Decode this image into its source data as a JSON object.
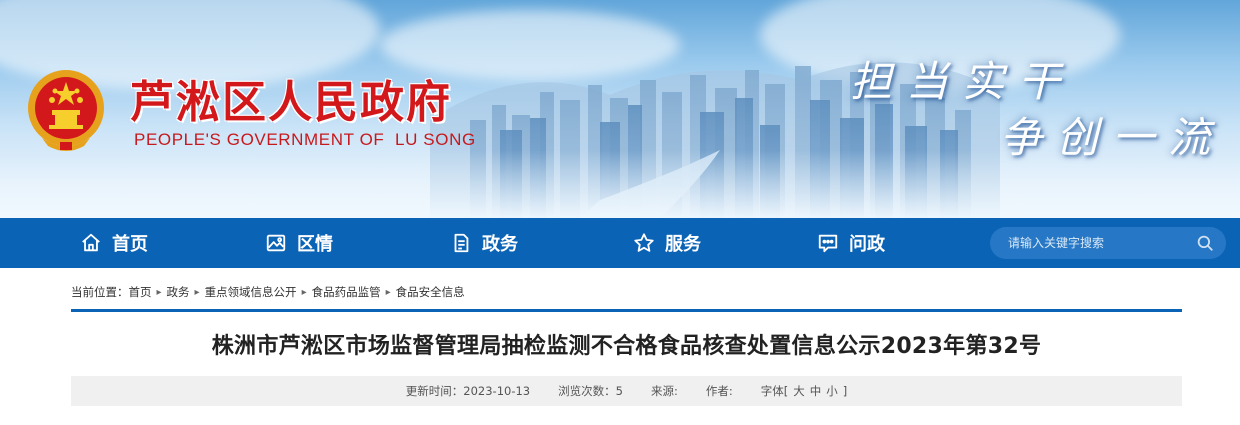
{
  "header": {
    "title": "芦淞区人民政府",
    "subtitle": "PEOPLE'S GOVERNMENT OF  LU SONG",
    "slogan_line1": "担当实干",
    "slogan_line2": "争创一流",
    "emblem_icon": "national-emblem-icon"
  },
  "nav": {
    "items": [
      {
        "label": "首页",
        "icon": "home-icon"
      },
      {
        "label": "区情",
        "icon": "picture-icon"
      },
      {
        "label": "政务",
        "icon": "document-icon"
      },
      {
        "label": "服务",
        "icon": "star-icon"
      },
      {
        "label": "问政",
        "icon": "chat-icon"
      }
    ],
    "search_placeholder": "请输入关键字搜索",
    "search_icon": "search-icon"
  },
  "breadcrumb": {
    "prefix": "当前位置：",
    "items": [
      "首页",
      "政务",
      "重点领域信息公开",
      "食品药品监管",
      "食品安全信息"
    ]
  },
  "article": {
    "title": "株洲市芦淞区市场监督管理局抽检监测不合格食品核查处置信息公示2023年第32号",
    "meta": {
      "updated": "更新时间：2023-10-13",
      "views": "浏览次数：5",
      "source": "来源:",
      "author": "作者:",
      "font_label": "字体[",
      "font_large": "大",
      "font_medium": "中",
      "font_small": "小",
      "font_close": "]"
    }
  },
  "colors": {
    "brand_red": "#d3181c",
    "nav_blue": "#0b63b6",
    "search_bg": "#2678c6"
  }
}
